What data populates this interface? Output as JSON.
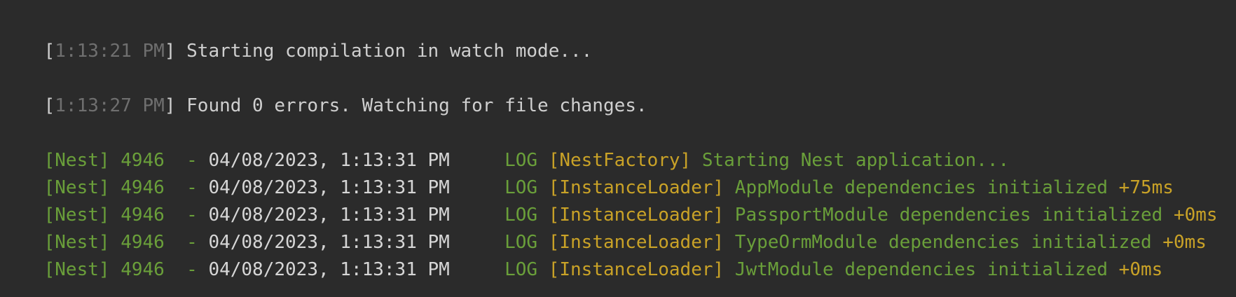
{
  "colors": {
    "background": "#2b2b2b",
    "text": "#cfcfcf",
    "timestamp": "#6f6f6f",
    "nest_green": "#6a9f3a",
    "context_yellow": "#c9a227"
  },
  "compile_lines": [
    {
      "open_bracket": "[",
      "time": "1:13:21 PM",
      "close_bracket": "]",
      "message": " Starting compilation in watch mode..."
    },
    {
      "open_bracket": "[",
      "time": "1:13:27 PM",
      "close_bracket": "]",
      "message": " Found 0 errors. Watching for file changes."
    }
  ],
  "nest_lines": [
    {
      "prefix": "[Nest] 4946  - ",
      "datetime": "04/08/2023, 1:13:31 PM",
      "level": "     LOG ",
      "context": "[NestFactory]",
      "message": " Starting Nest application..."
    },
    {
      "prefix": "[Nest] 4946  - ",
      "datetime": "04/08/2023, 1:13:31 PM",
      "level": "     LOG ",
      "context": "[InstanceLoader]",
      "message": " AppModule dependencies initialized",
      "timing": " +75ms"
    },
    {
      "prefix": "[Nest] 4946  - ",
      "datetime": "04/08/2023, 1:13:31 PM",
      "level": "     LOG ",
      "context": "[InstanceLoader]",
      "message": " PassportModule dependencies initialized",
      "timing": " +0ms"
    },
    {
      "prefix": "[Nest] 4946  - ",
      "datetime": "04/08/2023, 1:13:31 PM",
      "level": "     LOG ",
      "context": "[InstanceLoader]",
      "message": " TypeOrmModule dependencies initialized",
      "timing": " +0ms"
    },
    {
      "prefix": "[Nest] 4946  - ",
      "datetime": "04/08/2023, 1:13:31 PM",
      "level": "     LOG ",
      "context": "[InstanceLoader]",
      "message": " JwtModule dependencies initialized",
      "timing": " +0ms"
    }
  ]
}
